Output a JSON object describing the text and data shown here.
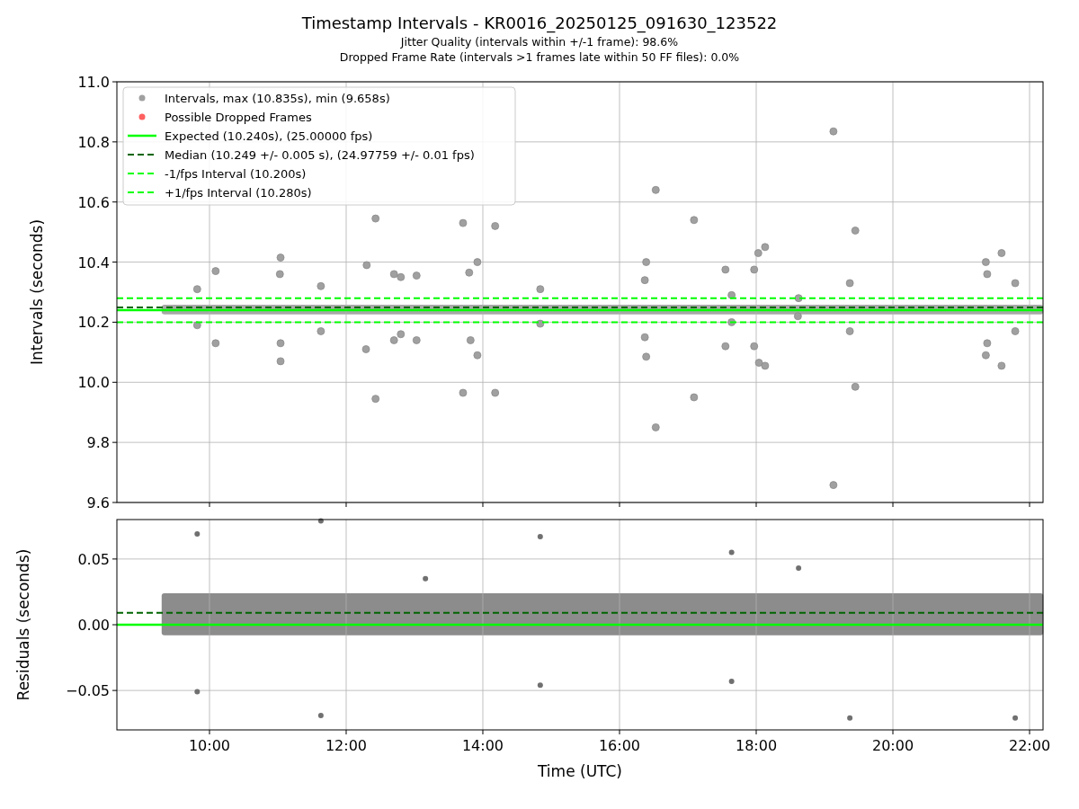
{
  "figure": {
    "title": "Timestamp Intervals - KR0016_20250125_091630_123522",
    "subtitles": [
      "Jitter Quality (intervals within +/-1 frame): 98.6%",
      "Dropped Frame Rate (intervals >1 frames late within 50 FF files): 0.0%"
    ]
  },
  "charts": [
    {
      "chart_data": {
        "type": "scatter",
        "ylabel": "Intervals (seconds)",
        "legend": true,
        "grid": true,
        "xlim": [
          8.645,
          22.197
        ],
        "ylim": [
          9.6,
          11.0
        ],
        "yticks": [
          {
            "value": 9.6,
            "label": "9.6"
          },
          {
            "value": 9.8,
            "label": "9.8"
          },
          {
            "value": 10.0,
            "label": "10.0"
          },
          {
            "value": 10.2,
            "label": "10.2"
          },
          {
            "value": 10.4,
            "label": "10.4"
          },
          {
            "value": 10.6,
            "label": "10.6"
          },
          {
            "value": 10.8,
            "label": "10.8"
          },
          {
            "value": 11.0,
            "label": "11.0"
          }
        ],
        "series": [
          {
            "name": "Intervals, max (10.835s), min (9.658s)",
            "type": "scatter",
            "color": "#a0a0a0",
            "x": [
              9.82,
              9.82,
              10.09,
              10.09,
              11.04,
              11.03,
              11.04,
              11.04,
              11.63,
              11.63,
              12.3,
              12.29,
              12.43,
              12.43,
              12.7,
              12.8,
              12.8,
              12.7,
              13.03,
              13.03,
              13.71,
              13.71,
              13.8,
              13.82,
              13.92,
              13.92,
              14.18,
              14.18,
              14.84,
              14.84,
              16.37,
              16.39,
              16.37,
              16.39,
              16.53,
              16.53,
              17.09,
              17.09,
              17.55,
              17.55,
              17.64,
              17.64,
              17.97,
              17.97,
              18.03,
              18.04,
              18.13,
              18.13,
              18.62,
              18.61,
              19.13,
              19.13,
              19.37,
              19.37,
              19.45,
              19.45,
              21.36,
              21.38,
              21.36,
              21.38,
              21.59,
              21.59,
              21.79,
              21.79
            ],
            "values": [
              10.31,
              10.19,
              10.37,
              10.13,
              10.415,
              10.36,
              10.13,
              10.07,
              10.32,
              10.17,
              10.39,
              10.11,
              10.545,
              9.945,
              10.36,
              10.35,
              10.16,
              10.14,
              10.355,
              10.14,
              10.53,
              9.965,
              10.365,
              10.14,
              10.4,
              10.09,
              10.52,
              9.965,
              10.31,
              10.195,
              10.34,
              10.4,
              10.15,
              10.085,
              10.64,
              9.85,
              10.54,
              9.95,
              10.375,
              10.12,
              10.29,
              10.2,
              10.375,
              10.12,
              10.43,
              10.065,
              10.45,
              10.055,
              10.28,
              10.22,
              10.835,
              9.658,
              10.33,
              10.17,
              10.505,
              9.985,
              10.4,
              10.36,
              10.09,
              10.13,
              10.43,
              10.055,
              10.33,
              10.17
            ]
          },
          {
            "name": "Possible Dropped Frames",
            "type": "scatter",
            "color": "#ff6060"
          },
          {
            "name": "Expected (10.240s), (25.00000 fps)",
            "type": "line",
            "color": "#00ff00",
            "x": [
              8.645,
              22.197
            ],
            "values": [
              10.24,
              10.24
            ]
          },
          {
            "name": "Median (10.249 +/- 0.005 s), (24.97759 +/- 0.01 fps)",
            "type": "line",
            "line_style": "dashed",
            "color": "#006400",
            "x": [
              8.645,
              22.197
            ],
            "values": [
              10.249,
              10.249
            ]
          },
          {
            "name": "-1/fps Interval (10.200s)",
            "type": "line",
            "line_style": "dashed",
            "color": "#00ff00",
            "x": [
              8.645,
              22.197
            ],
            "values": [
              10.2,
              10.2
            ]
          },
          {
            "name": "+1/fps Interval (10.280s)",
            "type": "line",
            "line_style": "dashed",
            "color": "#00ff00",
            "x": [
              8.645,
              22.197
            ],
            "values": [
              10.28,
              10.28
            ]
          }
        ]
      }
    },
    {
      "chart_data": {
        "type": "scatter",
        "ylabel": "Residuals (seconds)",
        "xlabel": "Time (UTC)",
        "legend": false,
        "grid": true,
        "xlim": [
          8.645,
          22.197
        ],
        "ylim": [
          -0.08,
          0.08
        ],
        "xticks": [
          {
            "value": 10,
            "label": "10:00"
          },
          {
            "value": 12,
            "label": "12:00"
          },
          {
            "value": 14,
            "label": "14:00"
          },
          {
            "value": 16,
            "label": "16:00"
          },
          {
            "value": 18,
            "label": "18:00"
          },
          {
            "value": 20,
            "label": "20:00"
          },
          {
            "value": 22,
            "label": "22:00"
          }
        ],
        "yticks": [
          {
            "value": -0.05,
            "label": "−0.05"
          },
          {
            "value": 0,
            "label": "0.00"
          },
          {
            "value": 0.05,
            "label": "0.05"
          }
        ],
        "series": [
          {
            "type": "scatter",
            "color": "#707070",
            "x": [
              9.82,
              9.82,
              11.63,
              11.63,
              14.84,
              14.84,
              17.64,
              17.64,
              19.37,
              21.79,
              13.16,
              18.62
            ],
            "values": [
              0.069,
              -0.051,
              0.079,
              -0.069,
              0.067,
              -0.046,
              0.055,
              -0.043,
              -0.071,
              -0.071,
              0.035,
              0.043
            ]
          },
          {
            "type": "line",
            "line_style": "dashed",
            "color": "#006400",
            "x": [
              8.645,
              22.197
            ],
            "values": [
              0.009,
              0.009
            ]
          },
          {
            "type": "line",
            "color": "#00ff00",
            "x": [
              8.645,
              22.197
            ],
            "values": [
              0,
              0
            ]
          }
        ]
      }
    }
  ]
}
